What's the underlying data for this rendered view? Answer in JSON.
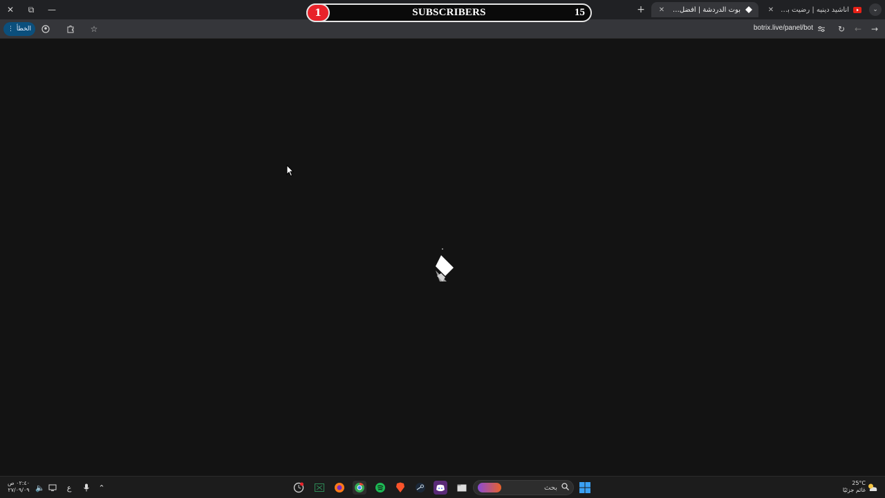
{
  "subscriber_overlay": {
    "left_count": "1",
    "label": "SUBSCRIBERS",
    "right_count": "15",
    "accent": "#e8222a"
  },
  "tabs": [
    {
      "title": "اناشيد دينيه | رضيت بالله ربا - بالإ",
      "icon": "youtube-icon",
      "active": false
    },
    {
      "title": "بوت الدردشة | أفضل برنامج لتعزيز",
      "icon": "botrix-icon",
      "active": true
    }
  ],
  "toolbar": {
    "error_label": "الخطأ",
    "url": "botrix.live/panel/bot"
  },
  "taskbar": {
    "search_placeholder": "بحث",
    "clock_time": "٠٢:٤٠ ص",
    "clock_date": "٢٧/٠٩/٠٩",
    "keyboard_lang": "ع",
    "weather_temp": "25°C",
    "weather_desc": "غائم جزئيًا"
  }
}
